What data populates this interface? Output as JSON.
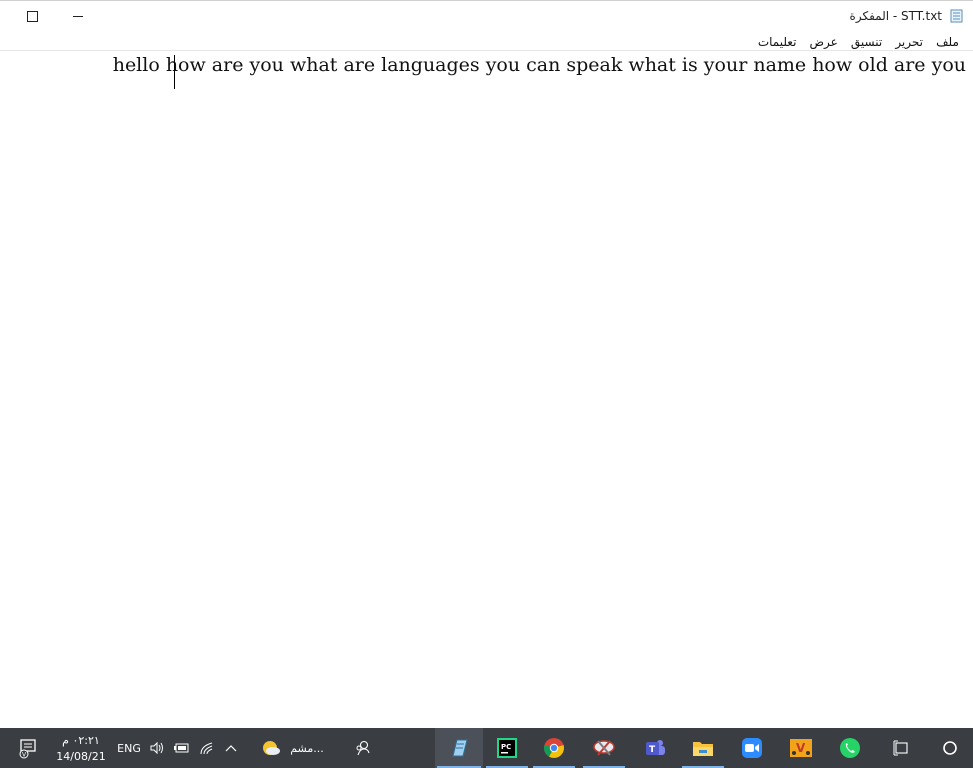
{
  "window": {
    "title": "STT.txt - المفكرة",
    "maximize_glyph": "☐",
    "minimize_glyph": "–"
  },
  "menu": [
    "ملف",
    "تحرير",
    "تنسيق",
    "عرض",
    "تعليمات"
  ],
  "editor": {
    "text": "hello how are you what are languages you can speak what is your name how old are you"
  },
  "taskbar": {
    "time": "٠٢:٢١ م",
    "date": "14/08/21",
    "language": "ENG",
    "weather_label": "مشم...",
    "apps": [
      "notepad",
      "pycharm",
      "chrome",
      "snipping-tool",
      "teams",
      "file-explorer",
      "zoom",
      "vlc-app",
      "whatsapp"
    ],
    "colors": {
      "background": "#3a3d42",
      "active_indicator": "#7eb4ea"
    }
  }
}
